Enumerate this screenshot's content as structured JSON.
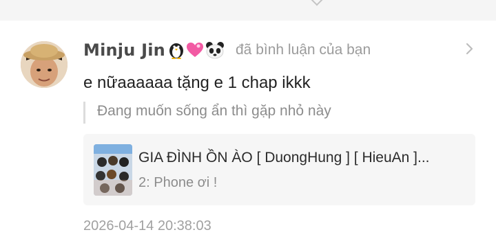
{
  "notification": {
    "username": "Minju Jin",
    "username_emojis": [
      "penguin-icon",
      "pink-heart-icon",
      "panda-icon"
    ],
    "action_text": "đã bình luận của bạn",
    "comment_text": "e nữaaaaaa tặng e 1 chap ikkk",
    "quoted_comment": "Đang muốn sống ẩn thì gặp nhỏ này",
    "manga": {
      "title": "GIA ĐÌNH ỒN ÀO [ DuongHung ] [ HieuAn ]...",
      "chapter": "2: Phone ơi !"
    },
    "timestamp": "2026-04-14 20:38:03"
  },
  "colors": {
    "username": "#4a4a4a",
    "muted": "#9b9b9b",
    "card_bg": "#f6f6f6",
    "quote_bar": "#dcdcdc"
  }
}
